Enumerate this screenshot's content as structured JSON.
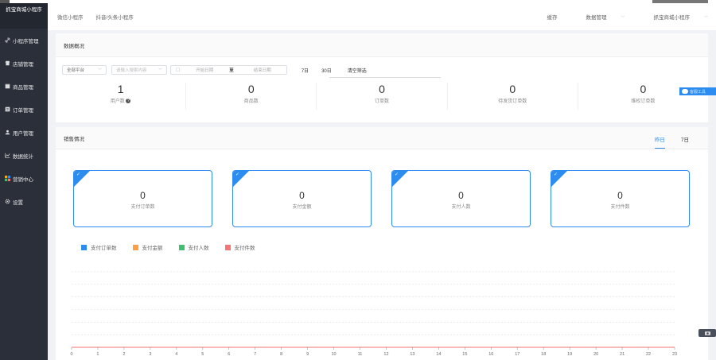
{
  "brand": {
    "title": "抓宝商城小程序"
  },
  "sidebar": {
    "items": [
      {
        "label": "小程序管理",
        "icon": "link-icon"
      },
      {
        "label": "店铺管理",
        "icon": "shop-icon"
      },
      {
        "label": "商品管理",
        "icon": "goods-icon"
      },
      {
        "label": "订单管理",
        "icon": "order-icon"
      },
      {
        "label": "用户管理",
        "icon": "user-icon"
      },
      {
        "label": "数据统计",
        "icon": "chart-icon"
      },
      {
        "label": "营销中心",
        "icon": "marketing-icon"
      },
      {
        "label": "设置",
        "icon": "gear-icon"
      }
    ]
  },
  "header": {
    "tabs": [
      "微信小程序",
      "抖音/头条小程序"
    ],
    "right": {
      "cache": "缓存",
      "data_mgmt": "数据管理",
      "account": "抓宝商城小程序"
    }
  },
  "overview": {
    "title": "数据概况",
    "platform_select": "全部平台",
    "search_placeholder": "请输入搜索内容",
    "start_placeholder": "开始日期",
    "range_sep": "至",
    "end_placeholder": "结束日期",
    "quick": [
      "7日",
      "30日"
    ],
    "clear": "清空筛选",
    "stats": [
      {
        "value": "1",
        "label": "用户数"
      },
      {
        "value": "0",
        "label": "商品数"
      },
      {
        "value": "0",
        "label": "订单数"
      },
      {
        "value": "0",
        "label": "待发货订单数"
      },
      {
        "value": "0",
        "label": "维权订单数"
      }
    ]
  },
  "float_button": {
    "label": "客服工具"
  },
  "sales": {
    "title": "销售情况",
    "tabs": [
      {
        "label": "昨日",
        "active": true
      },
      {
        "label": "7日",
        "active": false
      }
    ],
    "cards": [
      {
        "value": "0",
        "label": "支付订单数"
      },
      {
        "value": "0",
        "label": "支付金额"
      },
      {
        "value": "0",
        "label": "支付人数"
      },
      {
        "value": "0",
        "label": "支付件数"
      }
    ],
    "legend": [
      {
        "label": "支付订单数",
        "color": "#2d8cf0"
      },
      {
        "label": "支付金额",
        "color": "#ff9f43"
      },
      {
        "label": "支付人数",
        "color": "#3fbf6f"
      },
      {
        "label": "支付件数",
        "color": "#f37575"
      }
    ]
  },
  "chart_data": {
    "type": "line",
    "x": [
      0,
      1,
      2,
      3,
      4,
      5,
      6,
      7,
      8,
      9,
      10,
      11,
      12,
      13,
      14,
      15,
      16,
      17,
      18,
      19,
      20,
      21,
      22,
      23
    ],
    "series": [
      {
        "name": "支付订单数",
        "values": [
          0,
          0,
          0,
          0,
          0,
          0,
          0,
          0,
          0,
          0,
          0,
          0,
          0,
          0,
          0,
          0,
          0,
          0,
          0,
          0,
          0,
          0,
          0,
          0
        ]
      },
      {
        "name": "支付金额",
        "values": [
          0,
          0,
          0,
          0,
          0,
          0,
          0,
          0,
          0,
          0,
          0,
          0,
          0,
          0,
          0,
          0,
          0,
          0,
          0,
          0,
          0,
          0,
          0,
          0
        ]
      },
      {
        "name": "支付人数",
        "values": [
          0,
          0,
          0,
          0,
          0,
          0,
          0,
          0,
          0,
          0,
          0,
          0,
          0,
          0,
          0,
          0,
          0,
          0,
          0,
          0,
          0,
          0,
          0,
          0
        ]
      },
      {
        "name": "支付件数",
        "values": [
          0,
          0,
          0,
          0,
          0,
          0,
          0,
          0,
          0,
          0,
          0,
          0,
          0,
          0,
          0,
          0,
          0,
          0,
          0,
          0,
          0,
          0,
          0,
          0
        ]
      }
    ],
    "xlabel": "",
    "ylabel": "",
    "grid": true
  }
}
